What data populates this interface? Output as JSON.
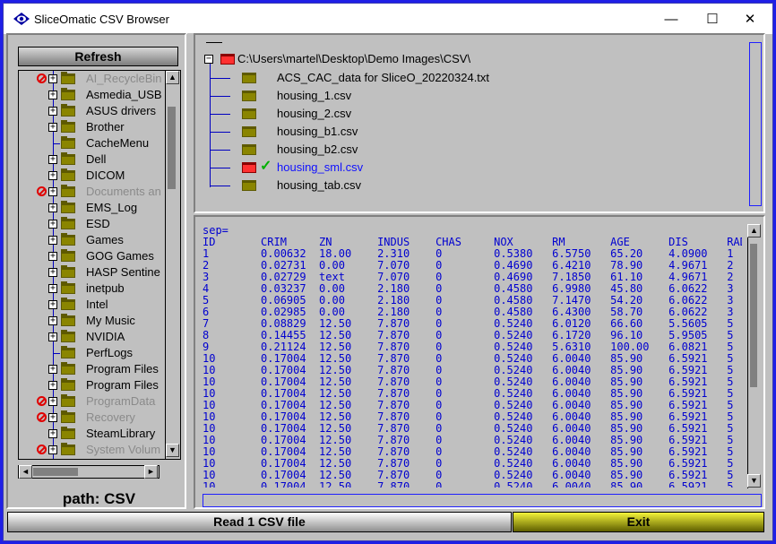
{
  "window": {
    "title": "SliceOmatic CSV Browser",
    "controls": {
      "minimize": "—",
      "maximize": "☐",
      "close": "✕"
    }
  },
  "left_panel": {
    "refresh_label": "Refresh",
    "path_label": "path:  CSV",
    "tree_items": [
      {
        "label": "AI_RecycleBin",
        "dim": true,
        "restricted": true,
        "expandable": true
      },
      {
        "label": "Asmedia_USB",
        "dim": false,
        "restricted": false,
        "expandable": true
      },
      {
        "label": "ASUS drivers",
        "dim": false,
        "restricted": false,
        "expandable": true
      },
      {
        "label": "Brother",
        "dim": false,
        "restricted": false,
        "expandable": true
      },
      {
        "label": "CacheMenu",
        "dim": false,
        "restricted": false,
        "expandable": false
      },
      {
        "label": "Dell",
        "dim": false,
        "restricted": false,
        "expandable": true
      },
      {
        "label": "DICOM",
        "dim": false,
        "restricted": false,
        "expandable": true
      },
      {
        "label": "Documents an",
        "dim": true,
        "restricted": true,
        "expandable": true
      },
      {
        "label": "EMS_Log",
        "dim": false,
        "restricted": false,
        "expandable": true
      },
      {
        "label": "ESD",
        "dim": false,
        "restricted": false,
        "expandable": true
      },
      {
        "label": "Games",
        "dim": false,
        "restricted": false,
        "expandable": true
      },
      {
        "label": "GOG Games",
        "dim": false,
        "restricted": false,
        "expandable": true
      },
      {
        "label": "HASP Sentine",
        "dim": false,
        "restricted": false,
        "expandable": true
      },
      {
        "label": "inetpub",
        "dim": false,
        "restricted": false,
        "expandable": true
      },
      {
        "label": "Intel",
        "dim": false,
        "restricted": false,
        "expandable": true
      },
      {
        "label": "My Music",
        "dim": false,
        "restricted": false,
        "expandable": true
      },
      {
        "label": "NVIDIA",
        "dim": false,
        "restricted": false,
        "expandable": true
      },
      {
        "label": "PerfLogs",
        "dim": false,
        "restricted": false,
        "expandable": false
      },
      {
        "label": "Program Files",
        "dim": false,
        "restricted": false,
        "expandable": true
      },
      {
        "label": "Program Files",
        "dim": false,
        "restricted": false,
        "expandable": true
      },
      {
        "label": "ProgramData",
        "dim": true,
        "restricted": true,
        "expandable": true
      },
      {
        "label": "Recovery",
        "dim": true,
        "restricted": true,
        "expandable": true
      },
      {
        "label": "SteamLibrary",
        "dim": false,
        "restricted": false,
        "expandable": true
      },
      {
        "label": "System Volum",
        "dim": true,
        "restricted": true,
        "expandable": true
      }
    ],
    "scroll_up": "▲",
    "scroll_down": "▼",
    "scroll_left": "◄",
    "scroll_right": "►"
  },
  "dir_panel": {
    "root_path": "C:\\Users\\martel\\Desktop\\Demo Images\\CSV\\",
    "files": [
      {
        "label": "ACS_CAC_data for SliceO_20220324.txt",
        "selected": false
      },
      {
        "label": "housing_1.csv",
        "selected": false
      },
      {
        "label": "housing_2.csv",
        "selected": false
      },
      {
        "label": "housing_b1.csv",
        "selected": false
      },
      {
        "label": "housing_b2.csv",
        "selected": false
      },
      {
        "label": "housing_sml.csv",
        "selected": true
      },
      {
        "label": "housing_tab.csv",
        "selected": false
      }
    ],
    "check_glyph": "✓"
  },
  "csv_panel": {
    "lines": [
      "sep=",
      "ID       CRIM     ZN       INDUS    CHAS     NOX      RM       AGE      DIS      RAD",
      "1        0.00632  18.00    2.310    0        0.5380   6.5750   65.20    4.0900   1",
      "2        0.02731  0.00     7.070    0        0.4690   6.4210   78.90    4.9671   2",
      "3        0.02729  text     7.070    0        0.4690   7.1850   61.10    4.9671   2",
      "4        0.03237  0.00     2.180    0        0.4580   6.9980   45.80    6.0622   3",
      "5        0.06905  0.00     2.180    0        0.4580   7.1470   54.20    6.0622   3",
      "6        0.02985  0.00     2.180    0        0.4580   6.4300   58.70    6.0622   3",
      "7        0.08829  12.50    7.870    0        0.5240   6.0120   66.60    5.5605   5",
      "8        0.14455  12.50    7.870    0        0.5240   6.1720   96.10    5.9505   5",
      "9        0.21124  12.50    7.870    0        0.5240   5.6310   100.00   6.0821   5",
      "10       0.17004  12.50    7.870    0        0.5240   6.0040   85.90    6.5921   5",
      "10       0.17004  12.50    7.870    0        0.5240   6.0040   85.90    6.5921   5",
      "10       0.17004  12.50    7.870    0        0.5240   6.0040   85.90    6.5921   5",
      "10       0.17004  12.50    7.870    0        0.5240   6.0040   85.90    6.5921   5",
      "10       0.17004  12.50    7.870    0        0.5240   6.0040   85.90    6.5921   5",
      "10       0.17004  12.50    7.870    0        0.5240   6.0040   85.90    6.5921   5",
      "10       0.17004  12.50    7.870    0        0.5240   6.0040   85.90    6.5921   5",
      "10       0.17004  12.50    7.870    0        0.5240   6.0040   85.90    6.5921   5",
      "10       0.17004  12.50    7.870    0        0.5240   6.0040   85.90    6.5921   5",
      "10       0.17004  12.50    7.870    0        0.5240   6.0040   85.90    6.5921   5",
      "10       0.17004  12.50    7.870    0        0.5240   6.0040   85.90    6.5921   5",
      "10       0.17004  12.50    7.870    0        0.5240   6.0040   85.90    6.5921   5"
    ],
    "scroll_up": "▲",
    "scroll_down": "▼"
  },
  "footer": {
    "read_label": "Read 1 CSV file",
    "exit_label": "Exit"
  }
}
